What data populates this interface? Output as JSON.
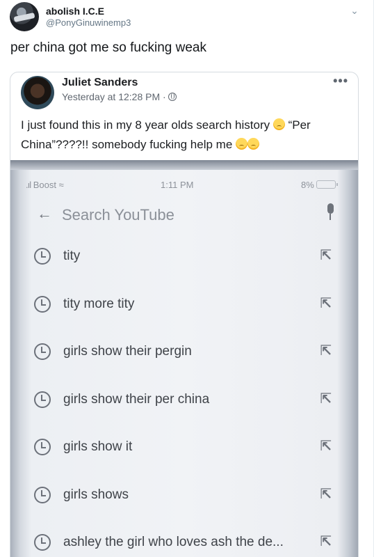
{
  "tweet": {
    "author_name": "abolish I.C.E",
    "author_handle": "@PonyGinuwinemp3",
    "text": "per china got me so fucking weak",
    "caret_icon": "chevron-down-icon"
  },
  "embedded_post": {
    "author_name": "Juliet Sanders",
    "timestamp": "Yesterday at 12:28 PM ·",
    "audience_icon": "globe-icon",
    "more_label": "•••",
    "text_part1": "I just found this in my 8 year olds search history",
    "text_part2": "“Per China”????!! somebody fucking help me",
    "emoji_icon": "persevering-face-emoji"
  },
  "photo": {
    "status_bar": {
      "carrier": "Boost",
      "time": "1:11 PM",
      "battery": "8%"
    },
    "search": {
      "placeholder": "Search YouTube"
    },
    "history": [
      {
        "label": "tity"
      },
      {
        "label": "tity more tity"
      },
      {
        "label": "girls show their pergin"
      },
      {
        "label": "girls show their per china"
      },
      {
        "label": "girls show it"
      },
      {
        "label": "girls shows"
      },
      {
        "label": "ashley the girl who loves ash the de..."
      }
    ]
  }
}
